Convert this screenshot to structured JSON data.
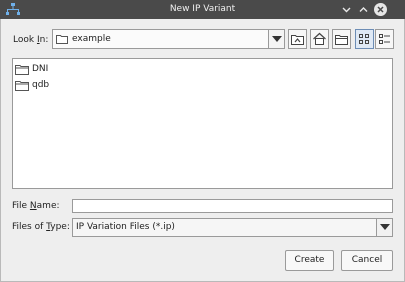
{
  "window": {
    "title": "New IP Variant",
    "controls": {
      "minimize_icon": "chevron-down-icon",
      "maximize_icon": "chevron-up-icon",
      "close_icon": "close-icon"
    }
  },
  "look_in": {
    "label_prefix": "Look ",
    "label_mnemonic": "I",
    "label_suffix": "n:",
    "value": "example"
  },
  "toolbar": {
    "buttons": [
      {
        "name": "up-one-level",
        "icon": "folder-up-icon"
      },
      {
        "name": "home",
        "icon": "home-icon"
      },
      {
        "name": "new-folder",
        "icon": "new-folder-icon"
      },
      {
        "name": "list-view",
        "icon": "list-view-icon",
        "selected": true
      },
      {
        "name": "details-view",
        "icon": "details-view-icon"
      }
    ]
  },
  "files": [
    {
      "name": "DNI",
      "icon": "folder-icon"
    },
    {
      "name": "qdb",
      "icon": "folder-icon"
    }
  ],
  "file_name": {
    "label_prefix": "File ",
    "label_mnemonic": "N",
    "label_suffix": "ame:",
    "value": "",
    "placeholder": ""
  },
  "file_type": {
    "label_prefix": "Files of ",
    "label_mnemonic": "T",
    "label_suffix": "ype:",
    "value": "IP Variation Files (*.ip)"
  },
  "buttons": {
    "create": "Create",
    "cancel": "Cancel"
  },
  "colors": {
    "titlebar": "#4a4a4a",
    "title_text": "#f0f0f0",
    "close_button": "#e6e6e6",
    "dialog_bg": "#eeeeee",
    "selected_toolbar": "#dfe9f5"
  }
}
